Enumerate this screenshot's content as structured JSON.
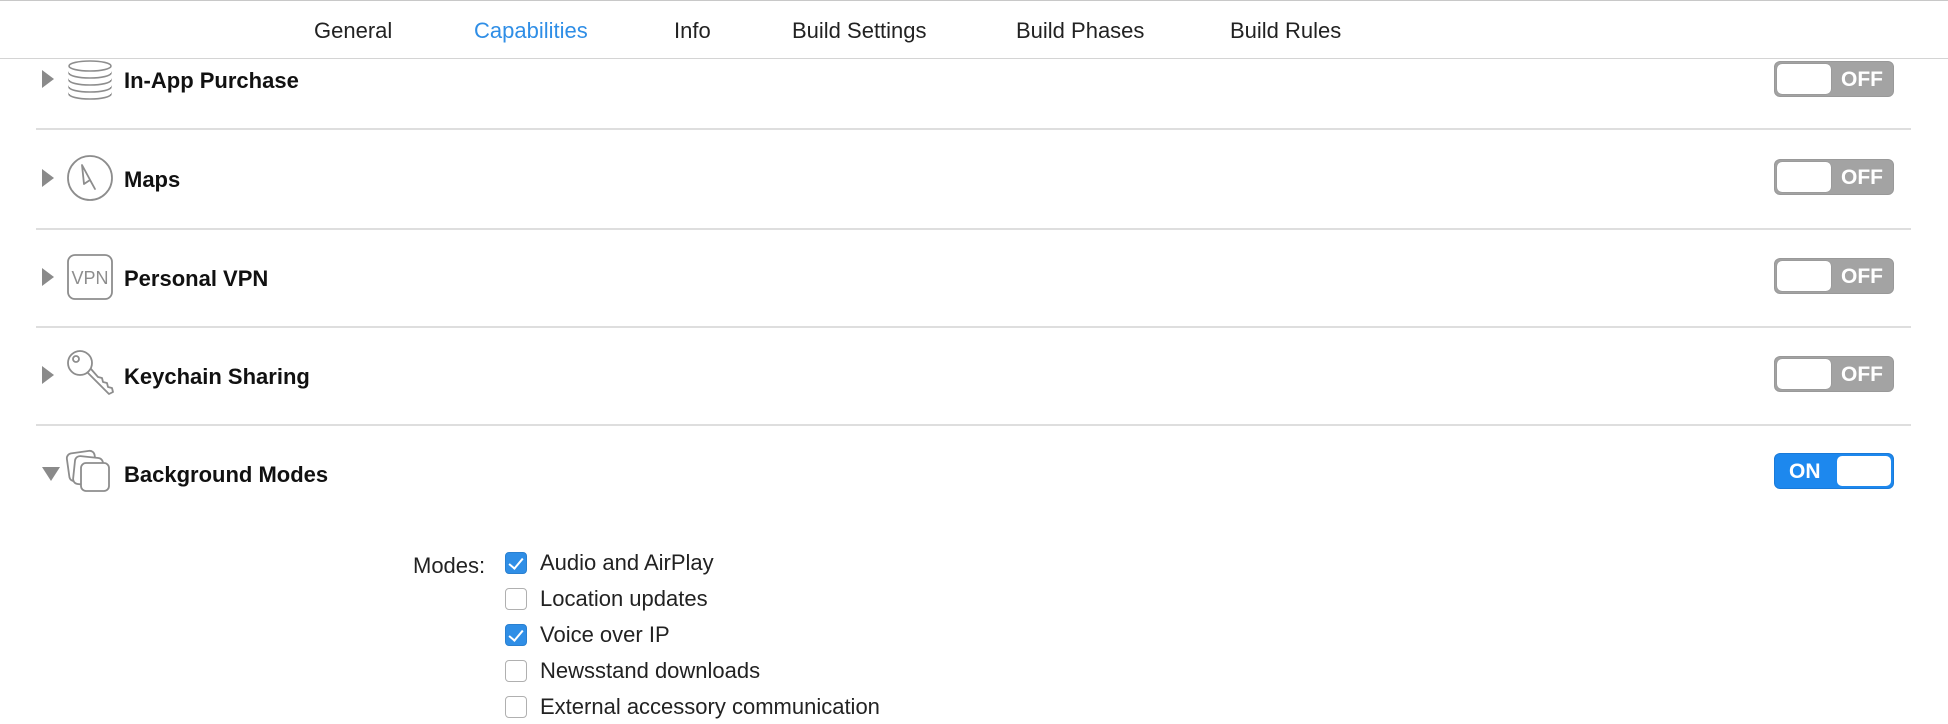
{
  "tabs": [
    {
      "label": "General",
      "active": false
    },
    {
      "label": "Capabilities",
      "active": true
    },
    {
      "label": "Info",
      "active": false
    },
    {
      "label": "Build Settings",
      "active": false
    },
    {
      "label": "Build Phases",
      "active": false
    },
    {
      "label": "Build Rules",
      "active": false
    }
  ],
  "capabilities": [
    {
      "title": "In-App Purchase",
      "icon": "coins-icon",
      "expanded": false,
      "toggle": "OFF"
    },
    {
      "title": "Maps",
      "icon": "compass-icon",
      "expanded": false,
      "toggle": "OFF"
    },
    {
      "title": "Personal VPN",
      "icon": "vpn-icon",
      "icon_text": "VPN",
      "expanded": false,
      "toggle": "OFF"
    },
    {
      "title": "Keychain Sharing",
      "icon": "key-icon",
      "expanded": false,
      "toggle": "OFF"
    },
    {
      "title": "Background Modes",
      "icon": "stacked-cards-icon",
      "expanded": true,
      "toggle": "ON"
    }
  ],
  "background_modes": {
    "label": "Modes:",
    "items": [
      {
        "label": "Audio and AirPlay",
        "checked": true
      },
      {
        "label": "Location updates",
        "checked": false
      },
      {
        "label": "Voice over IP",
        "checked": true
      },
      {
        "label": "Newsstand downloads",
        "checked": false
      },
      {
        "label": "External accessory communication",
        "checked": false
      }
    ]
  },
  "colors": {
    "accent": "#2f8ee6",
    "toggle_on": "#1d88ee",
    "toggle_off": "#a3a3a3"
  }
}
